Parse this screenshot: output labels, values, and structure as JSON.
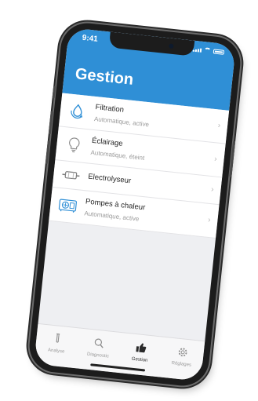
{
  "status_bar": {
    "time": "9:41"
  },
  "header": {
    "title": "Gestion"
  },
  "list": {
    "items": [
      {
        "title": "Filtration",
        "subtitle": "Automatique, active",
        "icon": "water-drop-cycle-icon"
      },
      {
        "title": "Éclairage",
        "subtitle": "Automatique, éteint",
        "icon": "light-bulb-icon"
      },
      {
        "title": "Electrolyseur",
        "subtitle": "",
        "icon": "electrolyser-icon"
      },
      {
        "title": "Pompes à chaleur",
        "subtitle": "Automatique, active",
        "icon": "heat-pump-icon"
      }
    ]
  },
  "tabbar": {
    "tabs": [
      {
        "label": "Analyse",
        "icon": "test-tube-icon"
      },
      {
        "label": "Diagnostic",
        "icon": "magnifier-icon"
      },
      {
        "label": "Gestion",
        "icon": "thumbs-up-icon",
        "active": true
      },
      {
        "label": "Réglages",
        "icon": "gear-icon"
      }
    ]
  },
  "colors": {
    "header": "#2f8fd6",
    "icon_accent": "#2f8fd6",
    "background": "#eeeff2"
  }
}
